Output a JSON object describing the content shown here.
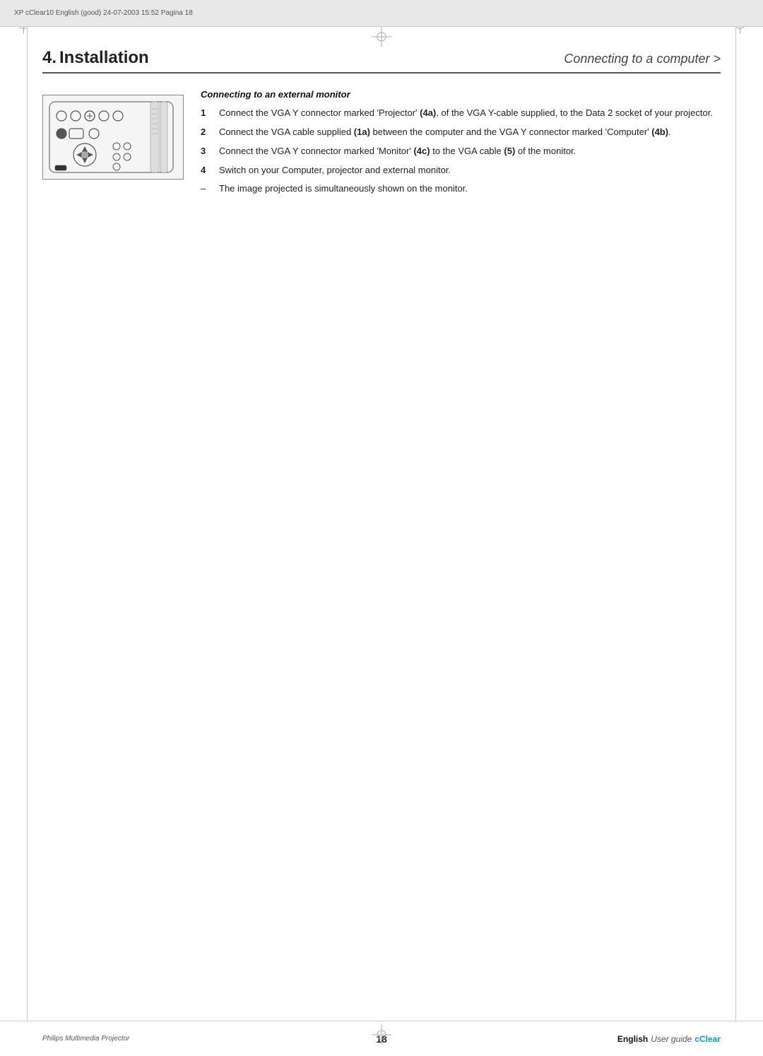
{
  "header": {
    "meta": "XP cClear10 English (good)  24-07-2003  15:52  Pagina 18"
  },
  "section": {
    "number": "4.",
    "title": "Installation",
    "subtitle": "Connecting to a computer >"
  },
  "connecting_section": {
    "title": "Connecting to an external monitor",
    "instructions": [
      {
        "number": "1",
        "text_parts": [
          {
            "text": "Connect the VGA Y connector marked 'Projector' ",
            "bold": false
          },
          {
            "text": "(4a)",
            "bold": true
          },
          {
            "text": ", of the VGA Y-cable supplied, to the Data 2 socket of your projector.",
            "bold": false
          }
        ],
        "full_text": "Connect the VGA Y connector marked 'Projector' (4a), of the VGA Y-cable supplied, to the Data 2 socket of your projector."
      },
      {
        "number": "2",
        "text_parts": [
          {
            "text": "Connect the VGA cable supplied ",
            "bold": false
          },
          {
            "text": "(1a)",
            "bold": true
          },
          {
            "text": " between the computer and the VGA Y connector marked 'Computer' ",
            "bold": false
          },
          {
            "text": "(4b)",
            "bold": true
          },
          {
            "text": ".",
            "bold": false
          }
        ],
        "full_text": "Connect the VGA cable supplied (1a) between the computer and the VGA Y connector marked 'Computer' (4b)."
      },
      {
        "number": "3",
        "text_parts": [
          {
            "text": "Connect the VGA Y connector marked 'Monitor' ",
            "bold": false
          },
          {
            "text": "(4c)",
            "bold": true
          },
          {
            "text": " to the VGA cable ",
            "bold": false
          },
          {
            "text": "(5)",
            "bold": true
          },
          {
            "text": " of the monitor.",
            "bold": false
          }
        ],
        "full_text": "Connect the VGA Y connector marked 'Monitor' (4c) to the VGA cable (5) of the monitor."
      },
      {
        "number": "4",
        "text_parts": [
          {
            "text": "Switch on your Computer, projector and external monitor.",
            "bold": false
          }
        ],
        "full_text": "Switch on your Computer, projector and external monitor."
      },
      {
        "number": "–",
        "text_parts": [
          {
            "text": "The image projected is simultaneously shown on the monitor.",
            "bold": false
          }
        ],
        "full_text": "The image projected is simultaneously shown on the monitor."
      }
    ]
  },
  "footer": {
    "brand": "Philips Multimedia Projector",
    "page": "18",
    "language": "English",
    "guide_label": "User guide",
    "product": "cClear"
  }
}
